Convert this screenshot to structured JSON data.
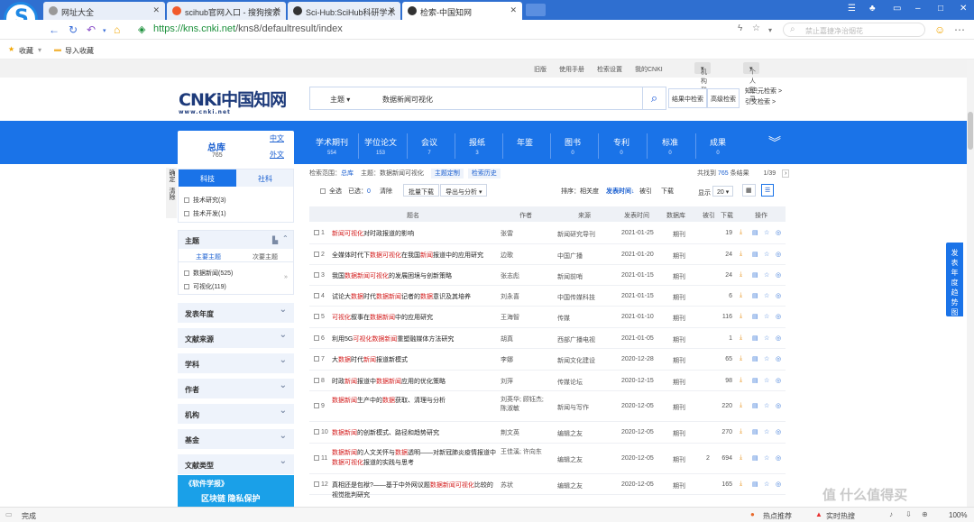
{
  "browser": {
    "tabs": [
      {
        "label": "网址大全"
      },
      {
        "label": "scihub官网入口 - 搜狗搜索"
      },
      {
        "label": "Sci-Hub:SciHub科研学术"
      },
      {
        "label": "检索-中国知网"
      }
    ],
    "url_host": "https://kns.cnki.net",
    "url_path": "/kns8/defaultresult/index",
    "search_placeholder": "禁止嘉捷净治烟花",
    "bookmarks": {
      "fav": "收藏",
      "import": "导入收藏"
    },
    "status_left": "完成",
    "status_items": [
      "热点推荐",
      "实时热搜",
      "100%"
    ],
    "watermark": "值 什么值得买"
  },
  "topnav": {
    "links": [
      "旧版",
      "使用手册",
      "检索设置",
      "我的CNKI"
    ],
    "org_login": "机构登录",
    "personal_login": "个人登录"
  },
  "brand": {
    "name": "CNKi中国知网",
    "url": "www.cnki.net"
  },
  "search": {
    "field": "主题",
    "query": "数据新闻可视化",
    "in_results": "结果中检索",
    "advanced": "高级检索",
    "knowledge": "知识元检索",
    "citation": "引文检索"
  },
  "zongku": {
    "label": "总库",
    "count": "765",
    "zh": "中文",
    "en": "外文"
  },
  "categories": [
    {
      "label": "学术期刊",
      "count": "554"
    },
    {
      "label": "学位论文",
      "count": "153"
    },
    {
      "label": "会议",
      "count": "7"
    },
    {
      "label": "报纸",
      "count": "3"
    },
    {
      "label": "年鉴",
      "count": ""
    },
    {
      "label": "图书",
      "count": "0"
    },
    {
      "label": "专利",
      "count": "0"
    },
    {
      "label": "标准",
      "count": "0"
    },
    {
      "label": "成果",
      "count": "0"
    }
  ],
  "sidetags": [
    "确定",
    "清除"
  ],
  "left": {
    "tab1": "科技",
    "tab2": "社科",
    "filters1": [
      "技术研究(3)",
      "技术开发(1)"
    ],
    "theme_title": "主题",
    "theme_tab1": "主要主题",
    "theme_tab2": "次要主题",
    "theme_items": [
      "数据新闻(525)",
      "可视化(119)"
    ],
    "facets": [
      "发表年度",
      "文献来源",
      "学科",
      "作者",
      "机构",
      "基金",
      "文献类型"
    ],
    "ad_line1": "《软件学报》",
    "ad_line2": "区块链  隐私保护"
  },
  "results": {
    "scope_label": "检索范围：",
    "scope_val": "总库",
    "theme_label": "主题：",
    "theme_val": "数据新闻可视化",
    "subscribe": "主题定制",
    "history": "检索历史",
    "total_prefix": "共找到",
    "total": "765",
    "total_suffix": "条结果",
    "page": "1/39",
    "select_all": "全选",
    "selected": "已选：",
    "selected_n": "0",
    "clear": "清除",
    "batch": "批量下载",
    "export": "导出与分析",
    "sort_label": "排序：",
    "sort_opts": [
      "相关度",
      "发表时间",
      "被引",
      "下载"
    ],
    "show_label": "显示",
    "show_n": "20",
    "headers": [
      "题名",
      "作者",
      "来源",
      "发表时间",
      "数据库",
      "被引",
      "下载",
      "操作"
    ],
    "rows": [
      {
        "n": "1",
        "t": "新闻可视化对时政报道的影响",
        "a": "张雷",
        "s": "新闻研究导刊",
        "d": "2021-01-25",
        "db": "期刊",
        "c": "",
        "dl": "19"
      },
      {
        "n": "2",
        "t": "全媒体时代下数据可视化在我国新闻报道中的应用研究",
        "a": "边歌",
        "s": "中国广播",
        "d": "2021-01-20",
        "db": "期刊",
        "c": "",
        "dl": "24"
      },
      {
        "n": "3",
        "t": "我国数据新闻可视化的发展困境与创新策略",
        "a": "张志彪",
        "s": "新闻前哨",
        "d": "2021-01-15",
        "db": "期刊",
        "c": "",
        "dl": "24"
      },
      {
        "n": "4",
        "t": "试论大数据时代数据新闻记者的数据意识及其培养",
        "a": "刘永喜",
        "s": "中国传媒科技",
        "d": "2021-01-15",
        "db": "期刊",
        "c": "",
        "dl": "6"
      },
      {
        "n": "5",
        "t": "可视化叙事在数据新闻中的应用研究",
        "a": "王海智",
        "s": "传媒",
        "d": "2021-01-10",
        "db": "期刊",
        "c": "",
        "dl": "116"
      },
      {
        "n": "6",
        "t": "利用5G可视化数据新闻重塑融媒体方法研究",
        "a": "胡真",
        "s": "西部广播电视",
        "d": "2021-01-05",
        "db": "期刊",
        "c": "",
        "dl": "1"
      },
      {
        "n": "7",
        "t": "大数据时代新闻报道新模式",
        "a": "李娜",
        "s": "新闻文化建设",
        "d": "2020-12-28",
        "db": "期刊",
        "c": "",
        "dl": "65"
      },
      {
        "n": "8",
        "t": "时政新闻报道中数据新闻应用的优化策略",
        "a": "刘萍",
        "s": "传媒论坛",
        "d": "2020-12-15",
        "db": "期刊",
        "c": "",
        "dl": "98"
      },
      {
        "n": "9",
        "t": "数据新闻生产中的数据获取、清理与分析",
        "a": "刘英华; 顾钰杰; 陈淑敏",
        "s": "新闻与写作",
        "d": "2020-12-05",
        "db": "期刊",
        "c": "",
        "dl": "220"
      },
      {
        "n": "10",
        "t": "数据新闻的创新模式、路径和趋势研究",
        "a": "荆文英",
        "s": "编辑之友",
        "d": "2020-12-05",
        "db": "期刊",
        "c": "",
        "dl": "270"
      },
      {
        "n": "11",
        "t": "数据新闻的人文关怀与数据透明——对新冠肺炎疫情报道中数据可视化报道的实践与思考",
        "a": "王佳溪; 许向东",
        "s": "编辑之友",
        "d": "2020-12-05",
        "db": "期刊",
        "c": "2",
        "dl": "694"
      },
      {
        "n": "12",
        "t": "真相还是包袱?——基于中外网议题数据新闻可视化比较的视觉批判研究",
        "a": "苏状",
        "s": "编辑之友",
        "d": "2020-12-05",
        "db": "期刊",
        "c": "",
        "dl": "165"
      }
    ],
    "highlights": [
      "数据新闻",
      "数据可视化",
      "数据",
      "新闻",
      "可视化"
    ]
  },
  "float_btn": "发表年度趋势图"
}
